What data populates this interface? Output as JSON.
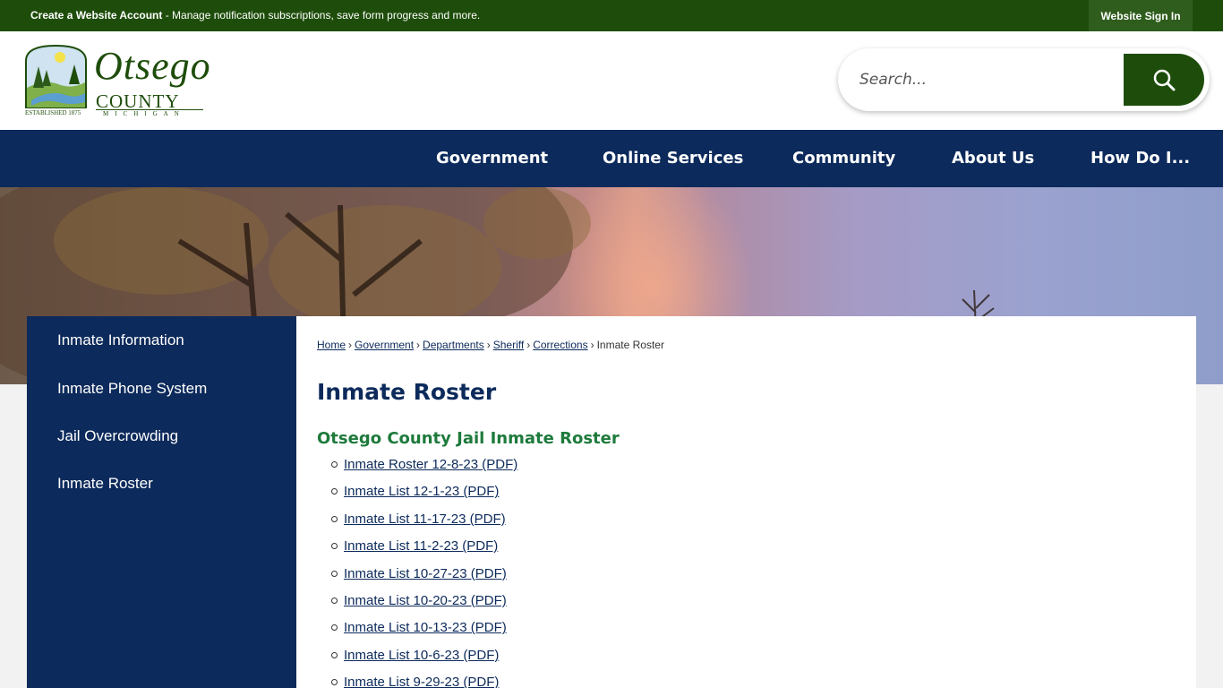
{
  "topbar": {
    "message_bold": "Create a Website Account",
    "message_rest": " - Manage notification subscriptions, save form progress and more.",
    "signin_label": "Website Sign In"
  },
  "logo": {
    "name": "Otsego",
    "county": "COUNTY",
    "state": "MICHIGAN",
    "established": "ESTABLISHED 1875"
  },
  "search": {
    "placeholder": "Search...",
    "button_icon": "search-icon"
  },
  "nav": {
    "items": [
      {
        "label": "Government"
      },
      {
        "label": "Online Services"
      },
      {
        "label": "Community"
      },
      {
        "label": "About Us"
      },
      {
        "label": "How Do I..."
      }
    ]
  },
  "sidebar": {
    "items": [
      {
        "label": "Inmate Information"
      },
      {
        "label": "Inmate Phone System"
      },
      {
        "label": "Jail Overcrowding"
      },
      {
        "label": "Inmate Roster"
      }
    ]
  },
  "breadcrumb": {
    "links": [
      "Home",
      "Government",
      "Departments",
      "Sheriff",
      "Corrections"
    ],
    "current": "Inmate Roster",
    "separator": "›"
  },
  "main": {
    "title": "Inmate Roster",
    "subtitle": "Otsego County Jail Inmate Roster",
    "documents": [
      "Inmate Roster 12-8-23 (PDF)",
      "Inmate List 12-1-23 (PDF)",
      "Inmate List 11-17-23 (PDF)",
      "Inmate List 11-2-23 (PDF)",
      "Inmate List 10-27-23 (PDF)",
      "Inmate List 10-20-23 (PDF)",
      "Inmate List 10-13-23 (PDF)",
      "Inmate List 10-6-23 (PDF)",
      "Inmate List 9-29-23 (PDF)"
    ]
  },
  "colors": {
    "brand_green": "#1e4d0b",
    "navy": "#0c2a5b",
    "subtitle_green": "#1e7a3c"
  }
}
